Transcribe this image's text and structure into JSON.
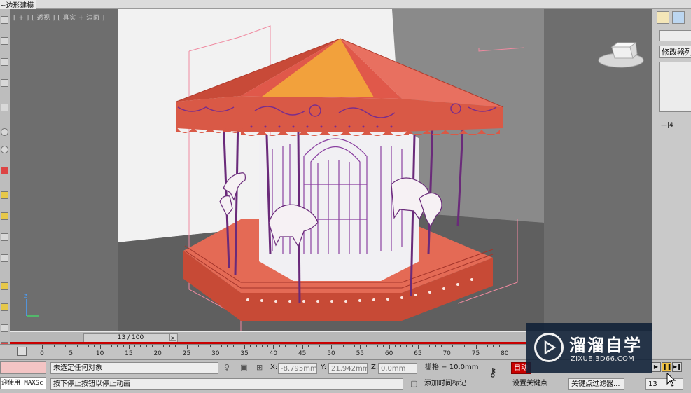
{
  "app": {
    "title_fragment": "~边形建模",
    "viewport_label": "[ + ] [ 透视 ] [ 真实 + 边面 ]"
  },
  "command_panel": {
    "modifier_list": "修改器列表",
    "stack_side_label": "—|4"
  },
  "time_slider": {
    "frame_readout": "13 / 100",
    "prev_arrow": "<",
    "next_arrow": ">"
  },
  "timeline": {
    "ticks": [
      "0",
      "5",
      "10",
      "15",
      "20",
      "25",
      "30",
      "35",
      "40",
      "45",
      "50",
      "55",
      "60",
      "65",
      "70",
      "75",
      "80"
    ]
  },
  "status": {
    "maxscript_label": "迎使用 MAXSc",
    "selection_text": "未选定任何对象",
    "prompt_text": "按下停止按钮以停止动画",
    "x_label": "X:",
    "x_value": "-8.795mm",
    "y_label": "Y:",
    "y_value": "21.942mm",
    "z_label": "Z:",
    "z_value": "0.0mm",
    "grid_text": "栅格 = 10.0mm",
    "add_time_tag": "添加时间标记",
    "auto_key": "自动",
    "set_key": "设置关键点",
    "key_filter": "关键点过滤器...",
    "frame_value": "13"
  },
  "watermark": {
    "name": "溜溜自学",
    "url": "ZIXUE.3D66.COM"
  },
  "colors": {
    "canopy": "#e05a45",
    "canopy_peak": "#f2a13c",
    "trim_purple": "#7a2d8c",
    "auto_key_red": "#c80000",
    "viewport_bg": "#6e6e6e"
  }
}
